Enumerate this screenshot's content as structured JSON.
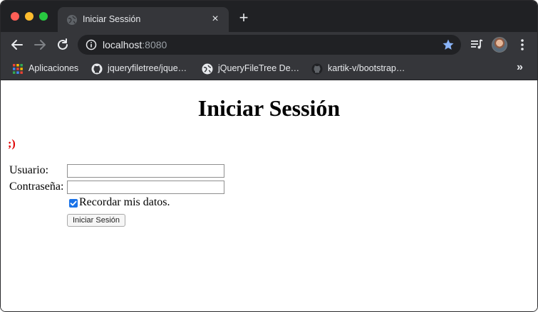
{
  "browser": {
    "tab": {
      "title": "Iniciar Sessión",
      "close_glyph": "×",
      "favicon": "globe-icon"
    },
    "new_tab_glyph": "+",
    "url": {
      "host": "localhost",
      "port": ":8080"
    },
    "bookmarks": [
      {
        "label": "Aplicaciones",
        "icon": "apps-grid-icon"
      },
      {
        "label": "jqueryfiletree/jque…",
        "icon": "github-icon"
      },
      {
        "label": "jQueryFileTree De…",
        "icon": "globe-icon"
      },
      {
        "label": "kartik-v/bootstrap…",
        "icon": "github-icon"
      }
    ],
    "bookmarks_more_glyph": "»"
  },
  "page": {
    "title": "Iniciar Sessión",
    "message": ";)",
    "form": {
      "username_label": "Usuario:",
      "username_value": "",
      "password_label": "Contraseña:",
      "password_value": "",
      "remember_label": "Recordar mis datos.",
      "remember_checked": true,
      "submit_label": "Iniciar Sesión"
    }
  },
  "colors": {
    "accent": "#1a73e8",
    "message": "#e00000",
    "star": "#8ab4f8"
  }
}
